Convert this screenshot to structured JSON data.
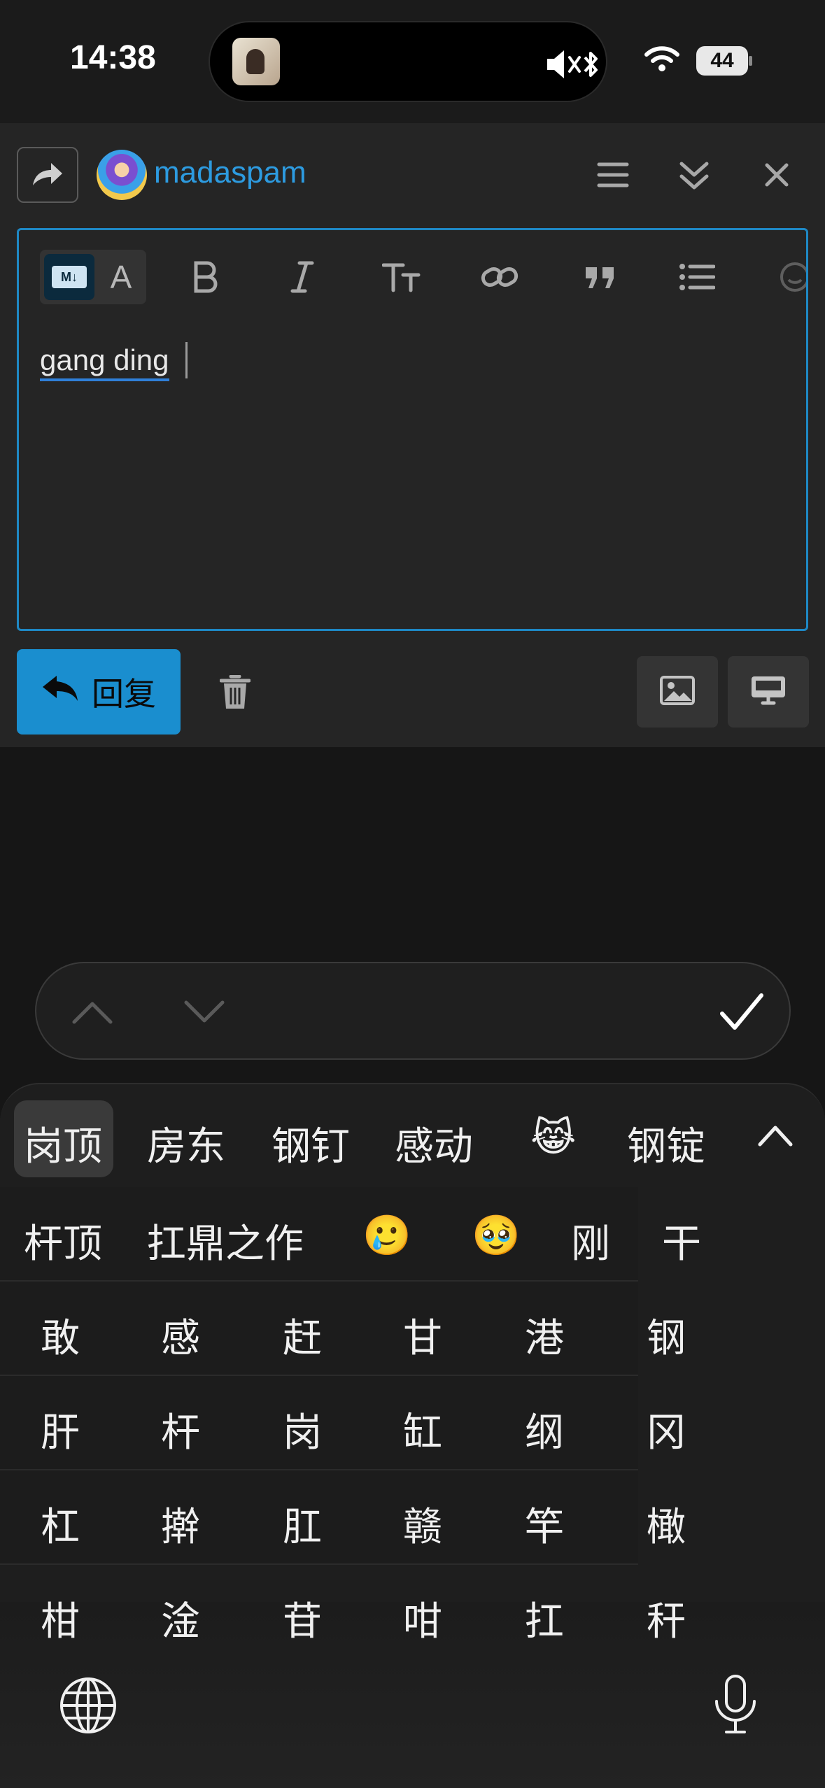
{
  "status_bar": {
    "time": "14:38",
    "battery": "44",
    "icons": [
      "mute-icon",
      "bluetooth-icon",
      "wifi-icon",
      "battery-icon"
    ]
  },
  "composer": {
    "username": "madaspam",
    "header_icons": [
      "share-icon",
      "menu-icon",
      "collapse-icon",
      "close-icon"
    ],
    "toolbar": {
      "markdown_badge": "M↓",
      "rich_text_label": "A",
      "buttons": [
        "bold-icon",
        "italic-icon",
        "heading-icon",
        "link-icon",
        "quote-icon",
        "list-icon",
        "emoji-icon"
      ]
    },
    "editor_text": "gang ding",
    "reply_label": "回复",
    "action_icons": [
      "trash-icon",
      "image-icon",
      "desktop-icon"
    ]
  },
  "accessory_bar": {
    "icons": [
      "chevron-up-icon",
      "chevron-down-icon",
      "checkmark-icon"
    ]
  },
  "keyboard": {
    "top_candidates": [
      "岗顶",
      "房东",
      "钢钉",
      "感动",
      "😹",
      "钢锭"
    ],
    "rows": [
      [
        "杆顶",
        "扛鼎之作",
        "🥲",
        "🥹",
        "刚",
        "干"
      ],
      [
        "敢",
        "感",
        "赶",
        "甘",
        "港",
        "钢"
      ],
      [
        "肝",
        "杆",
        "岗",
        "缸",
        "纲",
        "冈"
      ],
      [
        "杠",
        "擀",
        "肛",
        "赣",
        "竿",
        "橄"
      ],
      [
        "柑",
        "淦",
        "苷",
        "咁",
        "扛",
        "秆"
      ]
    ],
    "icons": [
      "chevron-up-icon",
      "globe-icon",
      "microphone-icon"
    ]
  }
}
